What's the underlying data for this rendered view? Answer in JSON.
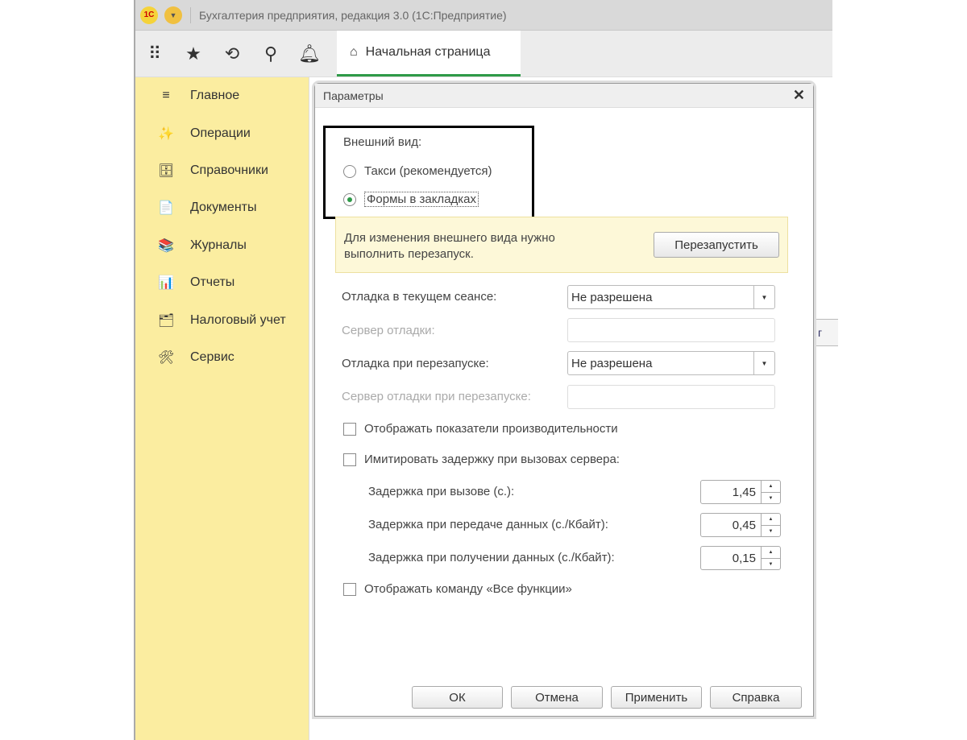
{
  "window": {
    "title": "Бухгалтерия предприятия, редакция 3.0  (1С:Предприятие)",
    "logo": "1С"
  },
  "toolbar": {
    "icons": [
      "apps-grid-icon",
      "favorites-star-icon",
      "history-icon",
      "search-icon",
      "bell-icon"
    ],
    "tab_label": "Начальная страница"
  },
  "sidebar": {
    "items": [
      {
        "label": "Главное",
        "icon": "≡"
      },
      {
        "label": "Операции",
        "icon": "✨"
      },
      {
        "label": "Справочники",
        "icon": "🗄"
      },
      {
        "label": "Документы",
        "icon": "📄"
      },
      {
        "label": "Журналы",
        "icon": "📚"
      },
      {
        "label": "Отчеты",
        "icon": "📊"
      },
      {
        "label": "Налоговый учет",
        "icon": "🗂"
      },
      {
        "label": "Сервис",
        "icon": "🛠"
      }
    ]
  },
  "behind_button": "г",
  "dialog": {
    "title": "Параметры",
    "appearance_label": "Внешний вид:",
    "radio_taxi": "Такси (рекомендуется)",
    "radio_tabs": "Формы в закладках",
    "selected_radio": "tabs",
    "notice": "Для изменения внешнего вида нужно выполнить перезапуск.",
    "restart_button": "Перезапустить",
    "debug_session_label": "Отладка в текущем сеансе:",
    "debug_session_value": "Не разрешена",
    "debug_server_label": "Сервер отладки:",
    "debug_restart_label": "Отладка при перезапуске:",
    "debug_restart_value": "Не разрешена",
    "debug_server_restart_label": "Сервер отладки при перезапуске:",
    "perf_checkbox": "Отображать показатели производительности",
    "delay_checkbox": "Имитировать задержку при вызовах сервера:",
    "delay_call_label": "Задержка при вызове (с.):",
    "delay_call_value": "1,45",
    "delay_send_label": "Задержка при передаче данных (с./Кбайт):",
    "delay_send_value": "0,45",
    "delay_recv_label": "Задержка при получении данных (с./Кбайт):",
    "delay_recv_value": "0,15",
    "all_functions_checkbox": "Отображать команду «Все функции»",
    "ok": "ОК",
    "cancel": "Отмена",
    "apply": "Применить",
    "help": "Справка"
  }
}
